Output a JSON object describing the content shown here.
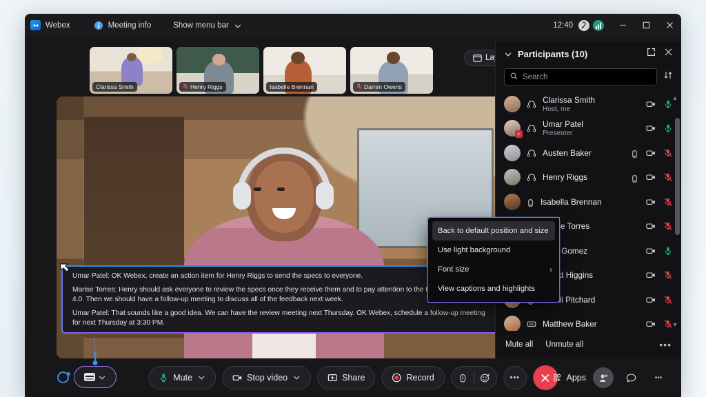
{
  "desktop": {
    "background_color": "#eef4f8"
  },
  "window": {
    "title": "Webex",
    "titlebar": {
      "app_label": "Webex",
      "meeting_info_label": "Meeting info",
      "show_menu_bar_label": "Show menu bar",
      "clock": "12:40",
      "minimize_label": "─",
      "maximize_label": "□",
      "close_label": "✕"
    }
  },
  "thumbnails": [
    {
      "name": "Clarissa Smith",
      "muted": false,
      "selected": false
    },
    {
      "name": "Henry Riggs",
      "muted": true,
      "selected": true
    },
    {
      "name": "Isabelle Brennan",
      "muted": false,
      "selected": false
    },
    {
      "name": "Darren Owens",
      "muted": true,
      "selected": false
    }
  ],
  "layout_button": {
    "label": "Layout",
    "icon": "layout-grid-icon"
  },
  "captions": {
    "lines": [
      "Umar Patel: OK Webex, create an action item for Henry Riggs to send the specs to everyone.",
      "Marise Torres: Henry should ask everyone to review the specs once they receive them and to pay attention to the t shown in section 4.0. Then we should have a follow-up meeting to discuss all of the feedback next week.",
      "Umar Patel: That sounds like a good idea. We can have the review meeting next Thursday. OK Webex, schedule a follow-up meeting for next Thursday at 3:30 PM."
    ]
  },
  "context_menu": {
    "items": [
      {
        "label": "Back to default position and size",
        "highlighted": true,
        "submenu": false
      },
      {
        "label": "Use light background",
        "highlighted": false,
        "submenu": false
      },
      {
        "label": "Font size",
        "highlighted": false,
        "submenu": true
      },
      {
        "label": "View captions and highlights",
        "highlighted": false,
        "submenu": false
      }
    ]
  },
  "toolbar": {
    "mute_label": "Mute",
    "stop_video_label": "Stop video",
    "share_label": "Share",
    "record_label": "Record",
    "more_label": "•••",
    "apps_label": "Apps",
    "leave_label": "✕",
    "participants_icon": "participants-icon",
    "chat_icon": "chat-bubble-icon",
    "overflow_icon": "more-options-icon",
    "cc_icon": "closed-captions-icon"
  },
  "participants_panel": {
    "title": "Participants (10)",
    "popout_icon": "open-in-new-icon",
    "close_icon": "close-icon",
    "search": {
      "placeholder": "Search",
      "value": ""
    },
    "sort_icon": "sort-icon",
    "footer": {
      "mute_all": "Mute all",
      "unmute_all": "Unmute all",
      "more": "•••"
    },
    "rows": [
      {
        "name": "Clarissa Smith",
        "sub": "Host, me",
        "device": "headset-icon",
        "video": "video-on-icon",
        "audio": "mic-on",
        "badge": null,
        "avatar": "a1"
      },
      {
        "name": "Umar Patel",
        "sub": "Presenter",
        "device": "headset-icon",
        "video": "video-on-icon",
        "audio": "mic-on",
        "badge": "+",
        "avatar": "a2"
      },
      {
        "name": "Austen Baker",
        "sub": "",
        "device": "headset-icon",
        "video": "video-on-icon",
        "audio": "mic-off",
        "extra": "mobile-icon",
        "avatar": "a3"
      },
      {
        "name": "Henry Riggs",
        "sub": "",
        "device": "headset-icon",
        "video": "video-on-icon",
        "audio": "mic-off",
        "extra": "mobile-icon",
        "avatar": "a4"
      },
      {
        "name": "Isabella Brennan",
        "sub": "",
        "device": "mobile-icon",
        "video": "video-on-icon",
        "audio": "mic-off",
        "avatar": "a5"
      },
      {
        "name": "Marise Torres",
        "sub": "",
        "device": "mobile-icon",
        "video": "video-on-icon",
        "audio": "mic-off",
        "avatar": "a6"
      },
      {
        "name": "Sofia Gomez",
        "sub": "",
        "device": "mobile-icon",
        "video": "video-on-icon",
        "audio": "mic-on",
        "avatar": "a7"
      },
      {
        "name": "Murad Higgins",
        "sub": "",
        "device": "mobile-icon",
        "video": "video-on-icon",
        "audio": "mic-off",
        "avatar": "a8"
      },
      {
        "name": "Sonali Pitchard",
        "sub": "",
        "device": "mobile-icon",
        "video": "video-on-icon",
        "audio": "mic-off",
        "avatar": "a9"
      },
      {
        "name": "Matthew Baker",
        "sub": "",
        "device": "device-icon",
        "video": "video-on-icon",
        "audio": "mic-off",
        "avatar": "a10"
      }
    ]
  },
  "colors": {
    "accent_purple": "#8b5cf6",
    "accent_blue": "#2f8fe0",
    "mic_on_green": "#23a77e",
    "mic_off_red": "#d9434f",
    "leave_red": "#e8404d",
    "panel_bg": "#121215",
    "window_bg": "#17171a"
  }
}
